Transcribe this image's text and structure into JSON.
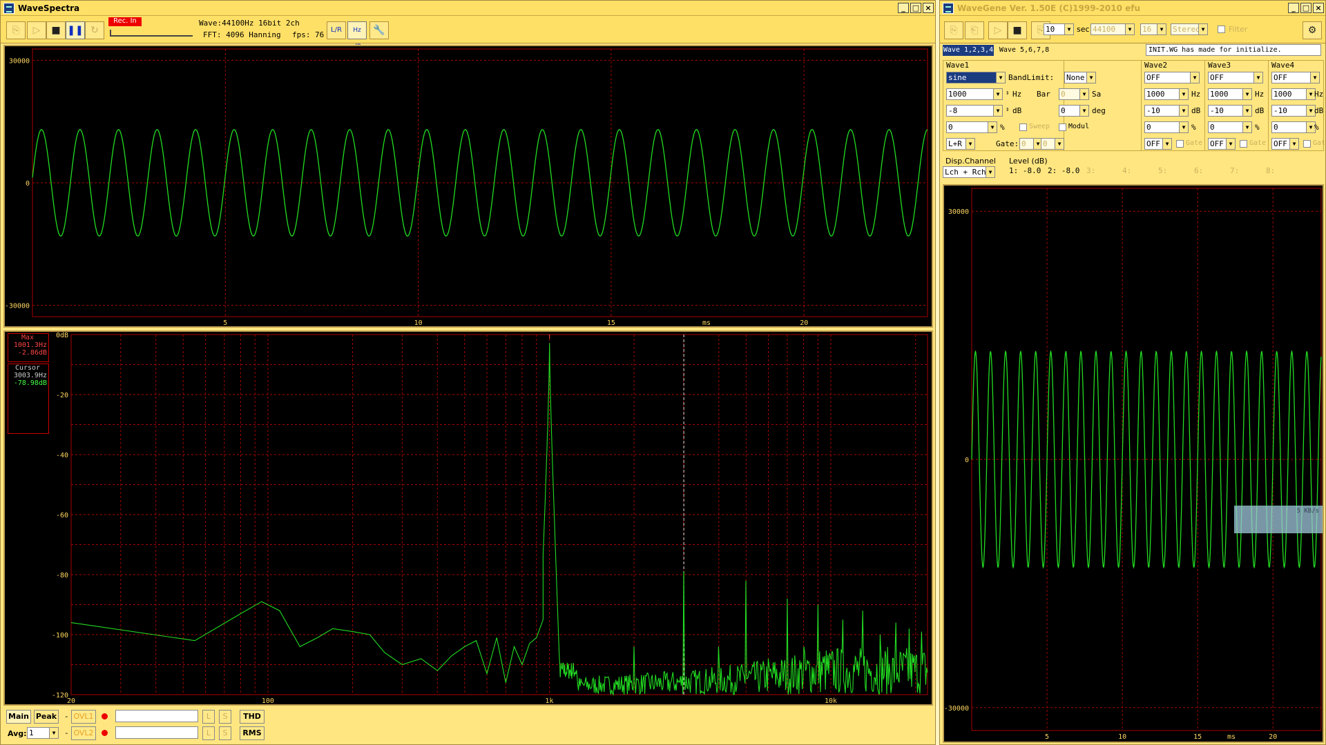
{
  "wavespectra": {
    "title": "WaveSpectra",
    "rec_button": "Rec. In",
    "wave_info": "Wave:44100Hz 16bit 2ch",
    "fft_info": "FFT: 4096 Hanning",
    "fps_label": "fps:",
    "fps_value": "76",
    "wave_plot": {
      "y_ticks": [
        "30000",
        "0",
        "-30000"
      ],
      "x_ticks": [
        "5",
        "10",
        "15",
        "20"
      ],
      "x_unit": "ms"
    },
    "spectrum_plot": {
      "y_ticks": [
        "0dB",
        "-20",
        "-40",
        "-60",
        "-80",
        "-100",
        "-120"
      ],
      "x_ticks": [
        "20",
        "100",
        "1k",
        "10k"
      ]
    },
    "max_box": {
      "label": "Max",
      "freq": "1001.3Hz",
      "level": "-2.86dB"
    },
    "cursor_box": {
      "label": "Cursor",
      "freq": "3003.9Hz",
      "level": "-78.98dB"
    },
    "bottom": {
      "main": "Main",
      "peak": "Peak",
      "dash1": "-",
      "ovl1": "OVL1",
      "avg_label": "Avg:",
      "avg_value": "1",
      "dash2": "-",
      "ovl2": "OVL2",
      "l1": "L",
      "s1": "S",
      "l2": "L",
      "s2": "S",
      "thd": "THD",
      "rms": "RMS"
    }
  },
  "wavegene": {
    "title": "WaveGene Ver. 1.50E (C)1999-2010 efu",
    "duration_value": "10",
    "sec_label": "sec",
    "rate_value": "44100",
    "bits_value": "16",
    "mode_value": "Stereo",
    "filter_label": "Filter",
    "tab1": "Wave 1,2,3,4",
    "tab2": "Wave 5,6,7,8",
    "status": "INIT.WG has made for initialize.",
    "wave1": {
      "title": "Wave1",
      "type": "sine",
      "freq": "1000",
      "level": "-8",
      "duty": "0",
      "channel": "L+R",
      "bandlimit_label": "BandLimit:",
      "bandlimit_value": "None",
      "bar_label": "Bar",
      "bar_value": "0",
      "phase_value": "0",
      "hz": "Hz",
      "db": "dB",
      "pct": "%",
      "sa": "Sa",
      "deg": "deg",
      "sweep": "Sweep",
      "modul": "Modul",
      "gate_label": "Gate:",
      "gate1": "0",
      "gate2": "0"
    },
    "wave2": {
      "title": "Wave2",
      "type": "OFF",
      "freq": "1000",
      "level": "-10",
      "duty": "0",
      "gate_sel": "OFF",
      "gate": "Gate"
    },
    "wave3": {
      "title": "Wave3",
      "type": "OFF",
      "freq": "1000",
      "level": "-10",
      "duty": "0",
      "gate_sel": "OFF",
      "gate": "Gate"
    },
    "wave4": {
      "title": "Wave4",
      "type": "OFF",
      "freq": "1000",
      "level": "-10",
      "duty": "0",
      "gate_sel": "OFF",
      "gate": "Gate"
    },
    "disp_channel_label": "Disp.Channel",
    "disp_channel_value": "Lch + Rch",
    "level_label": "Level (dB)",
    "levels": [
      "1: -8.0",
      "2: -8.0",
      "3:",
      "4:",
      "5:",
      "6:",
      "7:",
      "8:"
    ],
    "wave_plot": {
      "y_ticks": [
        "30000",
        "0",
        "-30000"
      ],
      "x_ticks": [
        "5",
        "10",
        "15",
        "20"
      ],
      "x_unit": "ms"
    },
    "overlay": {
      "text": "5 KB/s"
    }
  },
  "colors": {
    "trace": "#22dd22",
    "grid_red": "#aa0000",
    "window_bg": "#ffe680",
    "plot_bg": "#000000"
  }
}
